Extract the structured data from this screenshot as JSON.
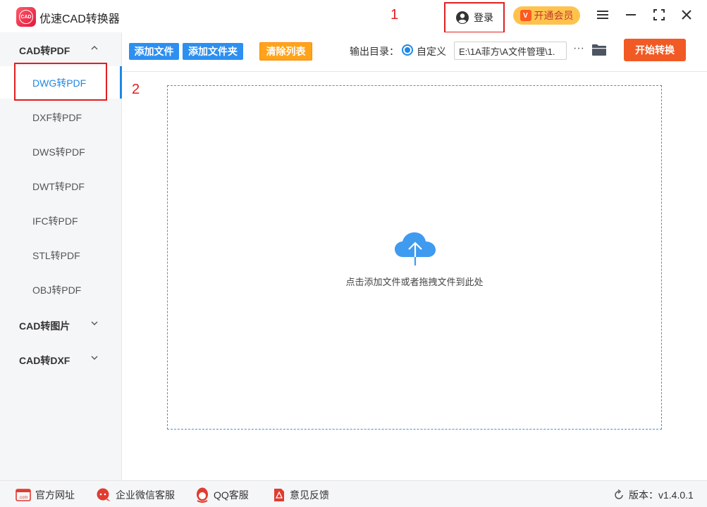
{
  "app": {
    "title": "优速CAD转换器",
    "logo_text": "CAD"
  },
  "annotations": {
    "one": "1",
    "two": "2"
  },
  "header": {
    "login_label": "登录",
    "vip_label": "开通会员",
    "vip_icon_text": "V"
  },
  "sidebar": {
    "categories": [
      {
        "label": "CAD转PDF",
        "expanded": true
      },
      {
        "label": "CAD转图片",
        "expanded": false
      },
      {
        "label": "CAD转DXF",
        "expanded": false
      }
    ],
    "items": [
      {
        "label": "DWG转PDF",
        "active": true
      },
      {
        "label": "DXF转PDF"
      },
      {
        "label": "DWS转PDF"
      },
      {
        "label": "DWT转PDF"
      },
      {
        "label": "IFC转PDF"
      },
      {
        "label": "STL转PDF"
      },
      {
        "label": "OBJ转PDF"
      }
    ]
  },
  "toolbar": {
    "add_file": "添加文件",
    "add_folder": "添加文件夹",
    "clear_list": "清除列表",
    "output_label": "输出目录：",
    "radio_label": "自定义",
    "path_value": "E:\\1A菲方\\A文件管理\\1.",
    "more": "···",
    "start": "开始转换"
  },
  "main": {
    "drop_hint": "点击添加文件或者拖拽文件到此处"
  },
  "footer": {
    "website": "官方网址",
    "wechat": "企业微信客服",
    "qq": "QQ客服",
    "feedback": "意见反馈",
    "version": "版本：v1.4.0.1"
  },
  "colors": {
    "accent": "#1e88e5",
    "start_button": "#f15a24",
    "clear_button": "#ffa31a",
    "annotation": "#e02020"
  }
}
